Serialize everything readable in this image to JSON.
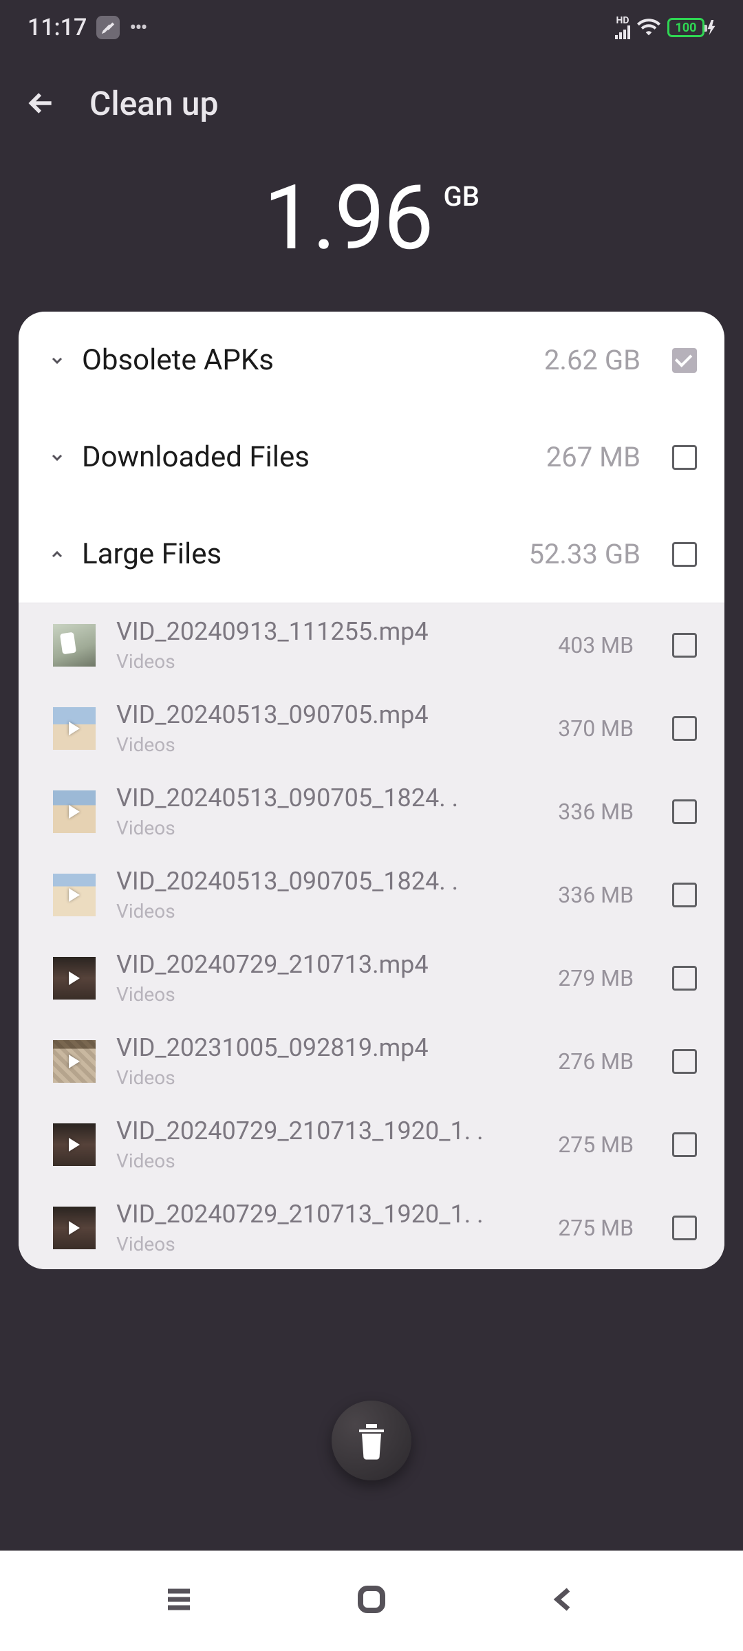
{
  "status": {
    "time": "11:17",
    "battery": "100"
  },
  "header": {
    "title": "Clean up"
  },
  "hero": {
    "value": "1.96",
    "unit": "GB"
  },
  "categories": [
    {
      "label": "Obsolete APKs",
      "size": "2.62 GB",
      "checked": true,
      "expanded": false
    },
    {
      "label": "Downloaded Files",
      "size": "267 MB",
      "checked": false,
      "expanded": false
    },
    {
      "label": "Large Files",
      "size": "52.33 GB",
      "checked": false,
      "expanded": true
    }
  ],
  "files": [
    {
      "name": "VID_20240913_111255.mp4",
      "category": "Videos",
      "size": "403 MB"
    },
    {
      "name": "VID_20240513_090705.mp4",
      "category": "Videos",
      "size": "370 MB"
    },
    {
      "name": "VID_20240513_090705_1824. .",
      "category": "Videos",
      "size": "336 MB"
    },
    {
      "name": "VID_20240513_090705_1824. .",
      "category": "Videos",
      "size": "336 MB"
    },
    {
      "name": "VID_20240729_210713.mp4",
      "category": "Videos",
      "size": "279 MB"
    },
    {
      "name": "VID_20231005_092819.mp4",
      "category": "Videos",
      "size": "276 MB"
    },
    {
      "name": "VID_20240729_210713_1920_1. .",
      "category": "Videos",
      "size": "275 MB"
    },
    {
      "name": "VID_20240729_210713_1920_1. .",
      "category": "Videos",
      "size": "275 MB"
    }
  ]
}
